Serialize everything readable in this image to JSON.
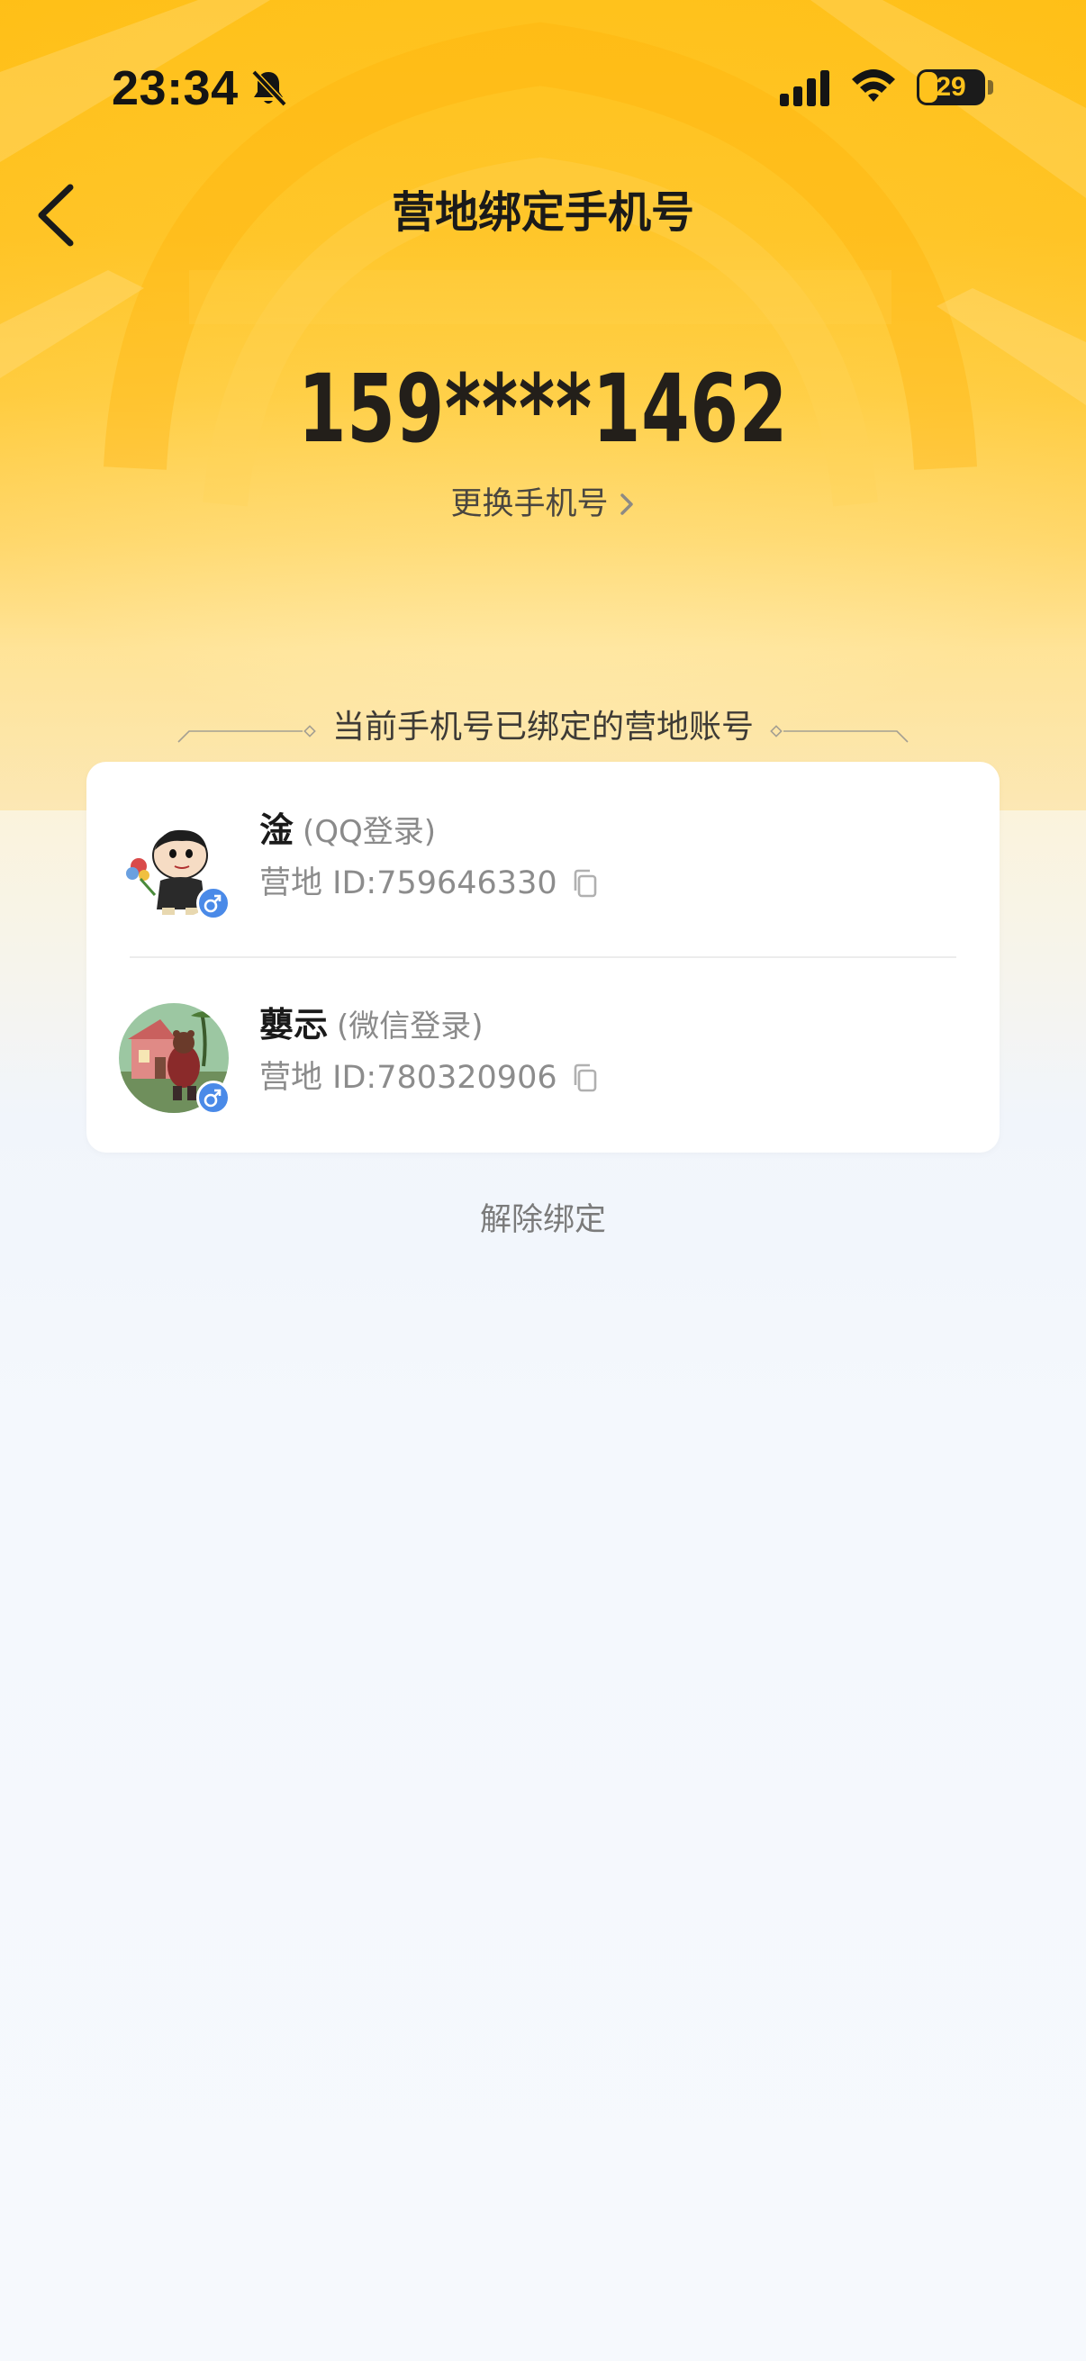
{
  "status_bar": {
    "time": "23:34",
    "battery": "29",
    "icons": [
      "bell-slash-icon",
      "cellular-signal-icon",
      "wifi-icon",
      "battery-icon"
    ]
  },
  "header": {
    "title": "营地绑定手机号",
    "back_icon": "chevron-left-icon"
  },
  "phone": {
    "number": "159****1462",
    "change_label": "更换手机号"
  },
  "section": {
    "title": "当前手机号已绑定的营地账号"
  },
  "accounts": [
    {
      "name": "淦",
      "login_method": "(QQ登录)",
      "id_text": "营地 ID:759646330",
      "gender": "male",
      "avatar": "cartoon-boy-avatar"
    },
    {
      "name": "蘡忈",
      "login_method": "(微信登录)",
      "id_text": "营地 ID:780320906",
      "gender": "male",
      "avatar": "cartoon-bear-house-avatar"
    }
  ],
  "actions": {
    "unbind_label": "解除绑定"
  },
  "colors": {
    "header_yellow": "#ffc21c",
    "background": "#f4f8fd",
    "gender_badge": "#4a8ae8"
  }
}
